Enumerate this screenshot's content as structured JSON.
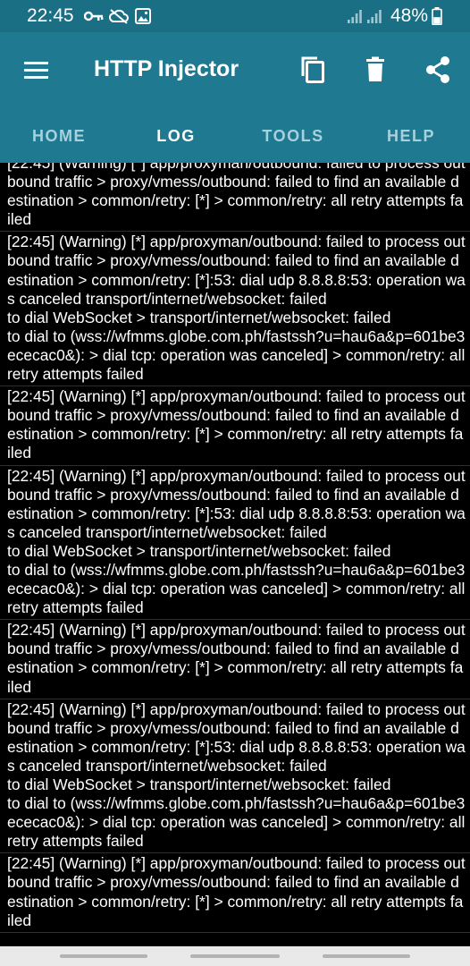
{
  "status_bar": {
    "time": "22:45",
    "icons": [
      "key-icon",
      "cloud-off-icon",
      "image-icon"
    ],
    "signal_icons": [
      "signal-icon",
      "signal-icon"
    ],
    "battery_percent": "48%",
    "battery_level": 0.48
  },
  "app_bar": {
    "title": "HTTP Injector",
    "menu_icon": "menu-icon",
    "actions": [
      "copy-icon",
      "delete-icon",
      "share-icon"
    ],
    "accent_color": "#1f7990"
  },
  "tabs": [
    {
      "label": "HOME",
      "active": false
    },
    {
      "label": "LOG",
      "active": true
    },
    {
      "label": "TOOLS",
      "active": false
    },
    {
      "label": "HELP",
      "active": false
    }
  ],
  "log": {
    "entries": [
      "[22:45] (Warning) [*] app/proxyman/outbound: failed to process outbound traffic > proxy/vmess/outbound: failed to find an available destination > common/retry: [*] > common/retry: all retry attempts failed",
      "[22:45] (Warning) [*] app/proxyman/outbound: failed to process outbound traffic > proxy/vmess/outbound: failed to find an available destination > common/retry: [*]:53: dial udp 8.8.8.8:53: operation was canceled transport/internet/websocket: failed\nto dial WebSocket > transport/internet/websocket: failed\nto dial to (wss://wfmms.globe.com.ph/fastssh?u=hau6a&p=601be3ececac0&): > dial tcp: operation was canceled] > common/retry: all retry attempts failed",
      "[22:45] (Warning) [*] app/proxyman/outbound: failed to process outbound traffic > proxy/vmess/outbound: failed to find an available destination > common/retry: [*] > common/retry: all retry attempts failed",
      "[22:45] (Warning) [*] app/proxyman/outbound: failed to process outbound traffic > proxy/vmess/outbound: failed to find an available destination > common/retry: [*]:53: dial udp 8.8.8.8:53: operation was canceled transport/internet/websocket: failed\nto dial WebSocket > transport/internet/websocket: failed\nto dial to (wss://wfmms.globe.com.ph/fastssh?u=hau6a&p=601be3ececac0&): > dial tcp: operation was canceled] > common/retry: all retry attempts failed",
      "[22:45] (Warning) [*] app/proxyman/outbound: failed to process outbound traffic > proxy/vmess/outbound: failed to find an available destination > common/retry: [*] > common/retry: all retry attempts failed",
      "[22:45] (Warning) [*] app/proxyman/outbound: failed to process outbound traffic > proxy/vmess/outbound: failed to find an available destination > common/retry: [*]:53: dial udp 8.8.8.8:53: operation was canceled transport/internet/websocket: failed\nto dial WebSocket > transport/internet/websocket: failed\nto dial to (wss://wfmms.globe.com.ph/fastssh?u=hau6a&p=601be3ececac0&): > dial tcp: operation was canceled] > common/retry: all retry attempts failed",
      "[22:45] (Warning) [*] app/proxyman/outbound: failed to process outbound traffic > proxy/vmess/outbound: failed to find an available destination > common/retry: [*] > common/retry: all retry attempts failed"
    ]
  },
  "nav_bar": {
    "items": [
      "recent-apps-button",
      "home-button",
      "back-button"
    ]
  }
}
